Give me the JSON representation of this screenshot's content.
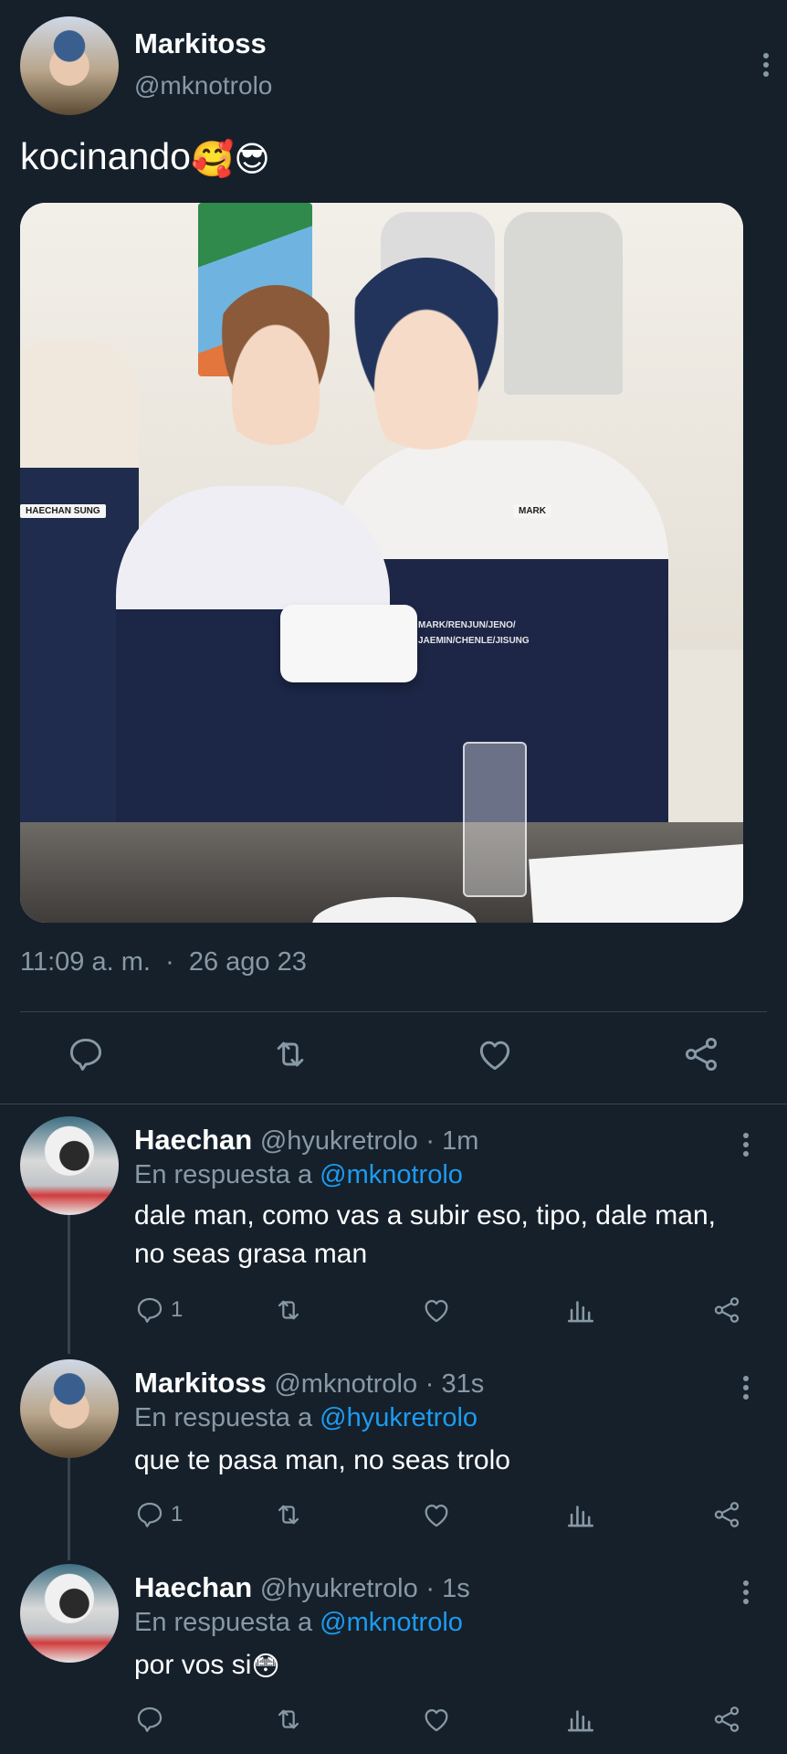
{
  "main_tweet": {
    "display_name": "Markitoss",
    "handle": "@mknotrolo",
    "text": "kocinando",
    "emojis": [
      "🥰",
      "😎"
    ],
    "photo_labels": {
      "left_apron": "HAECHAN SUNG",
      "name_tag": "MARK",
      "apron_text_1": "MARK/RENJUN/JENO/",
      "apron_text_2": "JAEMIN/CHENLE/JISUNG"
    },
    "time": "11:09 a. m.",
    "separator": "·",
    "date": "26 ago 23",
    "icons": [
      "reply-icon",
      "retweet-icon",
      "like-icon",
      "share-icon"
    ]
  },
  "replies": [
    {
      "display_name": "Haechan",
      "handle": "@hyukretrolo",
      "time_meta": "· 1m",
      "in_reply_prefix": "En respuesta a",
      "in_reply_to": "@mknotrolo",
      "text": "dale man, como vas a subir eso, tipo, dale man, no seas grasa man",
      "reply_count": "1"
    },
    {
      "display_name": "Markitoss",
      "handle": "@mknotrolo",
      "time_meta": "· 31s",
      "in_reply_prefix": "En respuesta a",
      "in_reply_to": "@hyukretrolo",
      "text": "que te pasa man, no seas trolo",
      "reply_count": "1"
    },
    {
      "display_name": "Haechan",
      "handle": "@hyukretrolo",
      "time_meta": "· 1s",
      "in_reply_prefix": "En respuesta a",
      "in_reply_to": "@mknotrolo",
      "text": "por vos si",
      "emoji": "😳",
      "reply_count": ""
    }
  ],
  "colors": {
    "background": "#15202b",
    "secondary_text": "#8899a6",
    "mention": "#1d9bf0",
    "divider": "#38444d"
  }
}
